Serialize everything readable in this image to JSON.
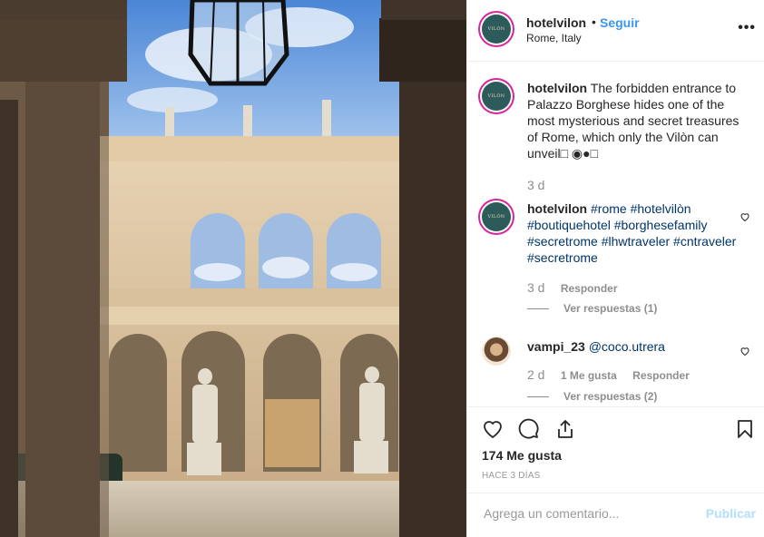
{
  "post": {
    "username": "hotelvilon",
    "follow_label": "Seguir",
    "separator": "•",
    "location": "Rome, Italy",
    "avatar_text": "VILÒN",
    "photo_alt": "Courtyard of Palazzo Borghese"
  },
  "caption": {
    "username": "hotelvilon",
    "text": "The forbidden entrance to Palazzo Borghese hides one of the most mysterious and secret treasures of Rome, which only the Vilòn can unveil□ ◉●□",
    "time": "3 d"
  },
  "comments": [
    {
      "username": "hotelvilon",
      "text": "#rome #hotelvilòn #boutiquehotel #borghesefamily #secretrome #lhwtraveler #cntraveler #secretrome",
      "time": "3 d",
      "reply_label": "Responder",
      "view_replies": "Ver respuestas (1)"
    },
    {
      "username": "vampi_23",
      "text": "@coco.utrera",
      "time": "2 d",
      "likes_label": "1 Me gusta",
      "reply_label": "Responder",
      "view_replies": "Ver respuestas (2)"
    }
  ],
  "stats": {
    "likes": "174 Me gusta",
    "date": "HACE 3 DÍAS"
  },
  "add_comment": {
    "placeholder": "Agrega un comentario...",
    "publish_label": "Publicar"
  },
  "icons": [
    "like-icon",
    "comment-icon",
    "share-icon",
    "save-icon",
    "more-options-icon"
  ],
  "colors": {
    "link": "#3897f0",
    "hashtag": "#003569",
    "muted": "#8e8e8e",
    "publish_disabled": "#b2dffc"
  }
}
